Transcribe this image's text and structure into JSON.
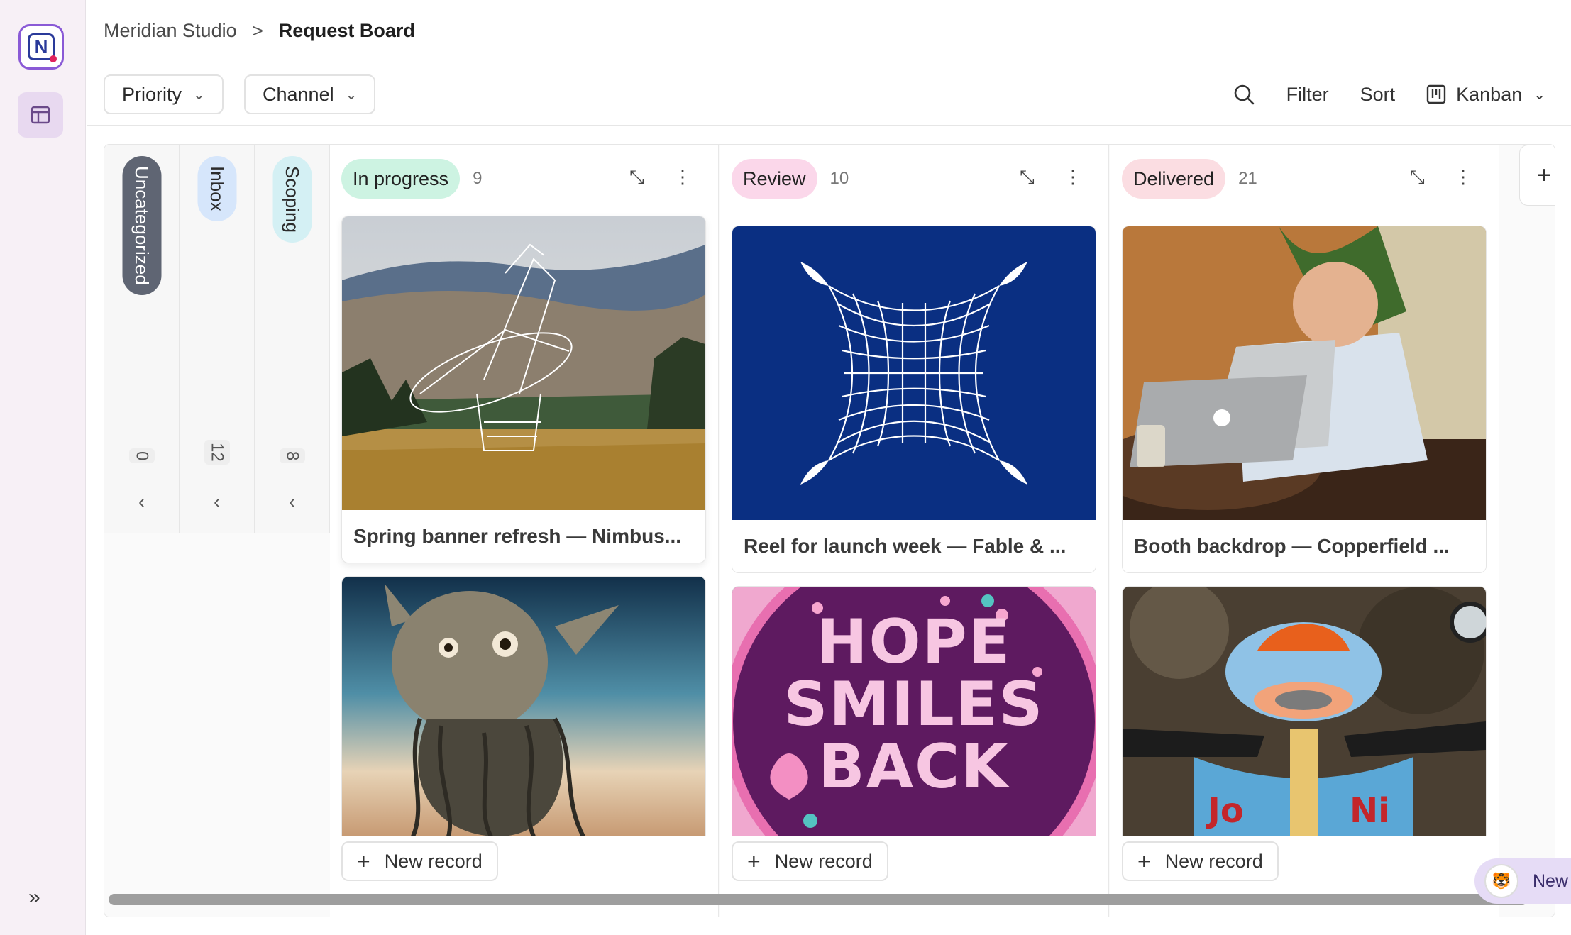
{
  "breadcrumb": {
    "workspace": "Meridian Studio",
    "separator": ">",
    "page": "Request Board"
  },
  "filters": {
    "priority": "Priority",
    "channel": "Channel"
  },
  "tools": {
    "filter": "Filter",
    "sort": "Sort",
    "view": "Kanban"
  },
  "collapsed_columns": [
    {
      "name": "Uncategorized",
      "count": "0",
      "color": "#5f6573",
      "text_color": "#ffffff"
    },
    {
      "name": "Inbox",
      "count": "12",
      "color": "#d6e6fb",
      "text_color": "#1f1f1f"
    },
    {
      "name": "Scoping",
      "count": "8",
      "color": "#d4f0f4",
      "text_color": "#1f1f1f"
    }
  ],
  "columns": [
    {
      "name": "In progress",
      "count": "9",
      "color": "#cdf3e2",
      "cards": [
        {
          "title": "Spring banner refresh — Nimbus...",
          "image": "radio-telescope-photo"
        },
        {
          "title": "",
          "image": "creature-portrait"
        }
      ]
    },
    {
      "name": "Review",
      "count": "10",
      "color": "#fbd7ea",
      "cards": [
        {
          "title": "Reel for launch week — Fable & ...",
          "image": "warped-grid-graphic"
        },
        {
          "title": "",
          "image": "hope-smiles-back-poster",
          "poster_text": [
            "HOPE",
            "SMILES",
            "BACK"
          ]
        }
      ]
    },
    {
      "name": "Delivered",
      "count": "21",
      "color": "#fbdde2",
      "cards": [
        {
          "title": "Booth backdrop — Copperfield ...",
          "image": "man-with-laptop-photo"
        },
        {
          "title": "",
          "image": "painted-scooter-photo",
          "sign_text": [
            "Jo",
            "Ni"
          ]
        }
      ]
    }
  ],
  "new_record_label": "New record",
  "new_chat_label": "New Chat",
  "add_column": "+"
}
